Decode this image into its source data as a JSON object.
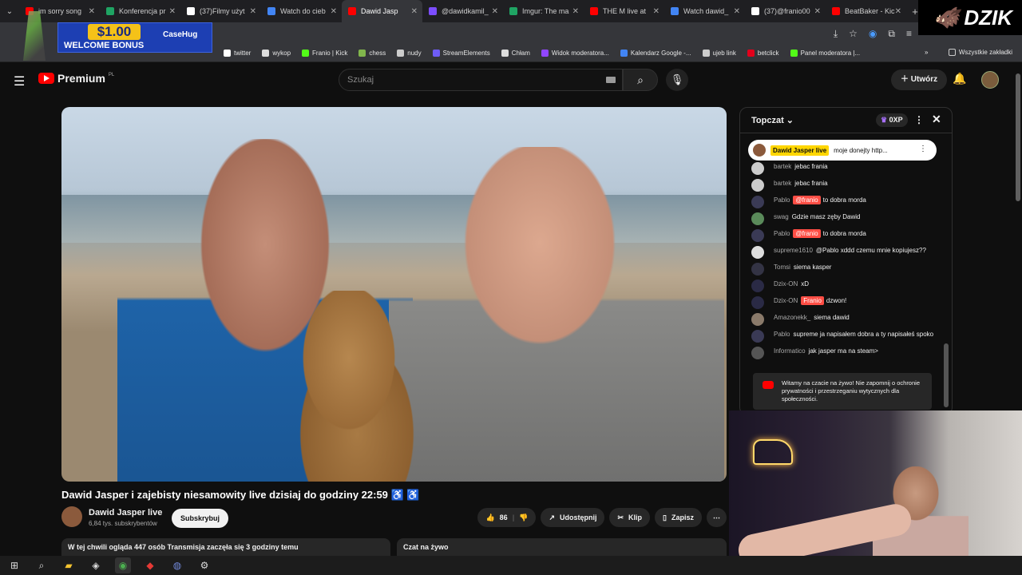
{
  "tabs": [
    {
      "label": "im sorry song",
      "color": "#ff0000"
    },
    {
      "label": "Konferencja pr",
      "color": "#1fa463"
    },
    {
      "label": "(37)Filmy użyt",
      "color": "#ffffff"
    },
    {
      "label": "Watch do cieb",
      "color": "#4285f4"
    },
    {
      "label": "Dawid Jasp",
      "color": "#ff0000",
      "active": true
    },
    {
      "label": "@dawidkamil_",
      "color": "#7c4dff"
    },
    {
      "label": "Imgur: The ma",
      "color": "#1fa463"
    },
    {
      "label": "THE M live at",
      "color": "#ff0000"
    },
    {
      "label": "Watch dawid_",
      "color": "#4285f4"
    },
    {
      "label": "(37)@franio00",
      "color": "#ffffff"
    },
    {
      "label": "BeatBaker - Kic",
      "color": "#ff0000"
    }
  ],
  "bookmarks": [
    {
      "label": "twitter",
      "color": "#ffffff"
    },
    {
      "label": "wykop",
      "color": "#dddddd"
    },
    {
      "label": "Franio | Kick",
      "color": "#53fc18"
    },
    {
      "label": "chess",
      "color": "#81b64c"
    },
    {
      "label": "nudy",
      "color": "#cccccc"
    },
    {
      "label": "StreamElements",
      "color": "#6e5cf6"
    },
    {
      "label": "Chłam",
      "color": "#dddddd"
    },
    {
      "label": "Widok moderatora...",
      "color": "#9146ff"
    },
    {
      "label": "Kalendarz Google -...",
      "color": "#4285f4"
    },
    {
      "label": "ujeb link",
      "color": "#cccccc"
    },
    {
      "label": "betclick",
      "color": "#e3001b"
    },
    {
      "label": "Panel moderatora |...",
      "color": "#53fc18"
    }
  ],
  "bookmarks_all": "Wszystkie zakładki",
  "promo": {
    "amount": "$1.00",
    "text": "WELCOME BONUS",
    "brand": "CaseHug"
  },
  "overlay_logo": "DZIK",
  "yt": {
    "logo": "Premium",
    "region": "PL",
    "search_placeholder": "Szukaj",
    "create": "Utwórz"
  },
  "video": {
    "title": "Dawid Jasper i zajebisty niesamowity live dzisiaj do godziny 22:59 ♿ ♿",
    "channel": "Dawid Jasper live",
    "subs": "6,84 tys. subskrybentów",
    "subscribe": "Subskrybuj",
    "likes": "86",
    "share": "Udostępnij",
    "clip": "Klip",
    "save": "Zapisz",
    "desc": "W tej chwili ogląda 447 osób  Transmisja zaczęła się 3 godziny temu",
    "live_chat": "Czat na żywo"
  },
  "chat": {
    "mode": "Topczat",
    "xp": "0XP",
    "pinned": {
      "name": "Dawid Jasper live",
      "text": "moje donejty http..."
    },
    "messages": [
      {
        "name": "bartek",
        "text": "jebac frania",
        "color": "#cccccc"
      },
      {
        "name": "bartek",
        "text": "jebac frania",
        "color": "#cccccc"
      },
      {
        "name": "Pablo",
        "tag": "@franio",
        "text": "to dobra morda",
        "color": "#3a3a55"
      },
      {
        "name": "swag",
        "text": "Gdzie masz zęby Dawid",
        "color": "#5a8a5a"
      },
      {
        "name": "Pablo",
        "tag": "@franio",
        "text": "to dobra morda",
        "color": "#3a3a55"
      },
      {
        "name": "supreme1610",
        "text": "@Pablo xddd czemu mnie kopiujesz??",
        "color": "#dddddd"
      },
      {
        "name": "Tomsi",
        "text": "siema kasper",
        "color": "#333344"
      },
      {
        "name": "Dzix-ON",
        "text": "xD",
        "color": "#2a2a45"
      },
      {
        "name": "Dzix-ON",
        "tag": "Franio",
        "text": "dzwon!",
        "color": "#2a2a45"
      },
      {
        "name": "Amazonekk_",
        "text": "siema dawid",
        "color": "#8a7a6a"
      },
      {
        "name": "Pablo",
        "text": "supreme ja napisałem dobra a ty napisałeś spoko",
        "color": "#3a3a55"
      },
      {
        "name": "Informatico",
        "text": "jak jasper ma na steam>",
        "color": "#555555"
      }
    ],
    "note": "Witamy na czacie na żywo! Nie zapomnij o ochronie prywatności i przestrzeganiu wytycznych dla społeczności."
  }
}
